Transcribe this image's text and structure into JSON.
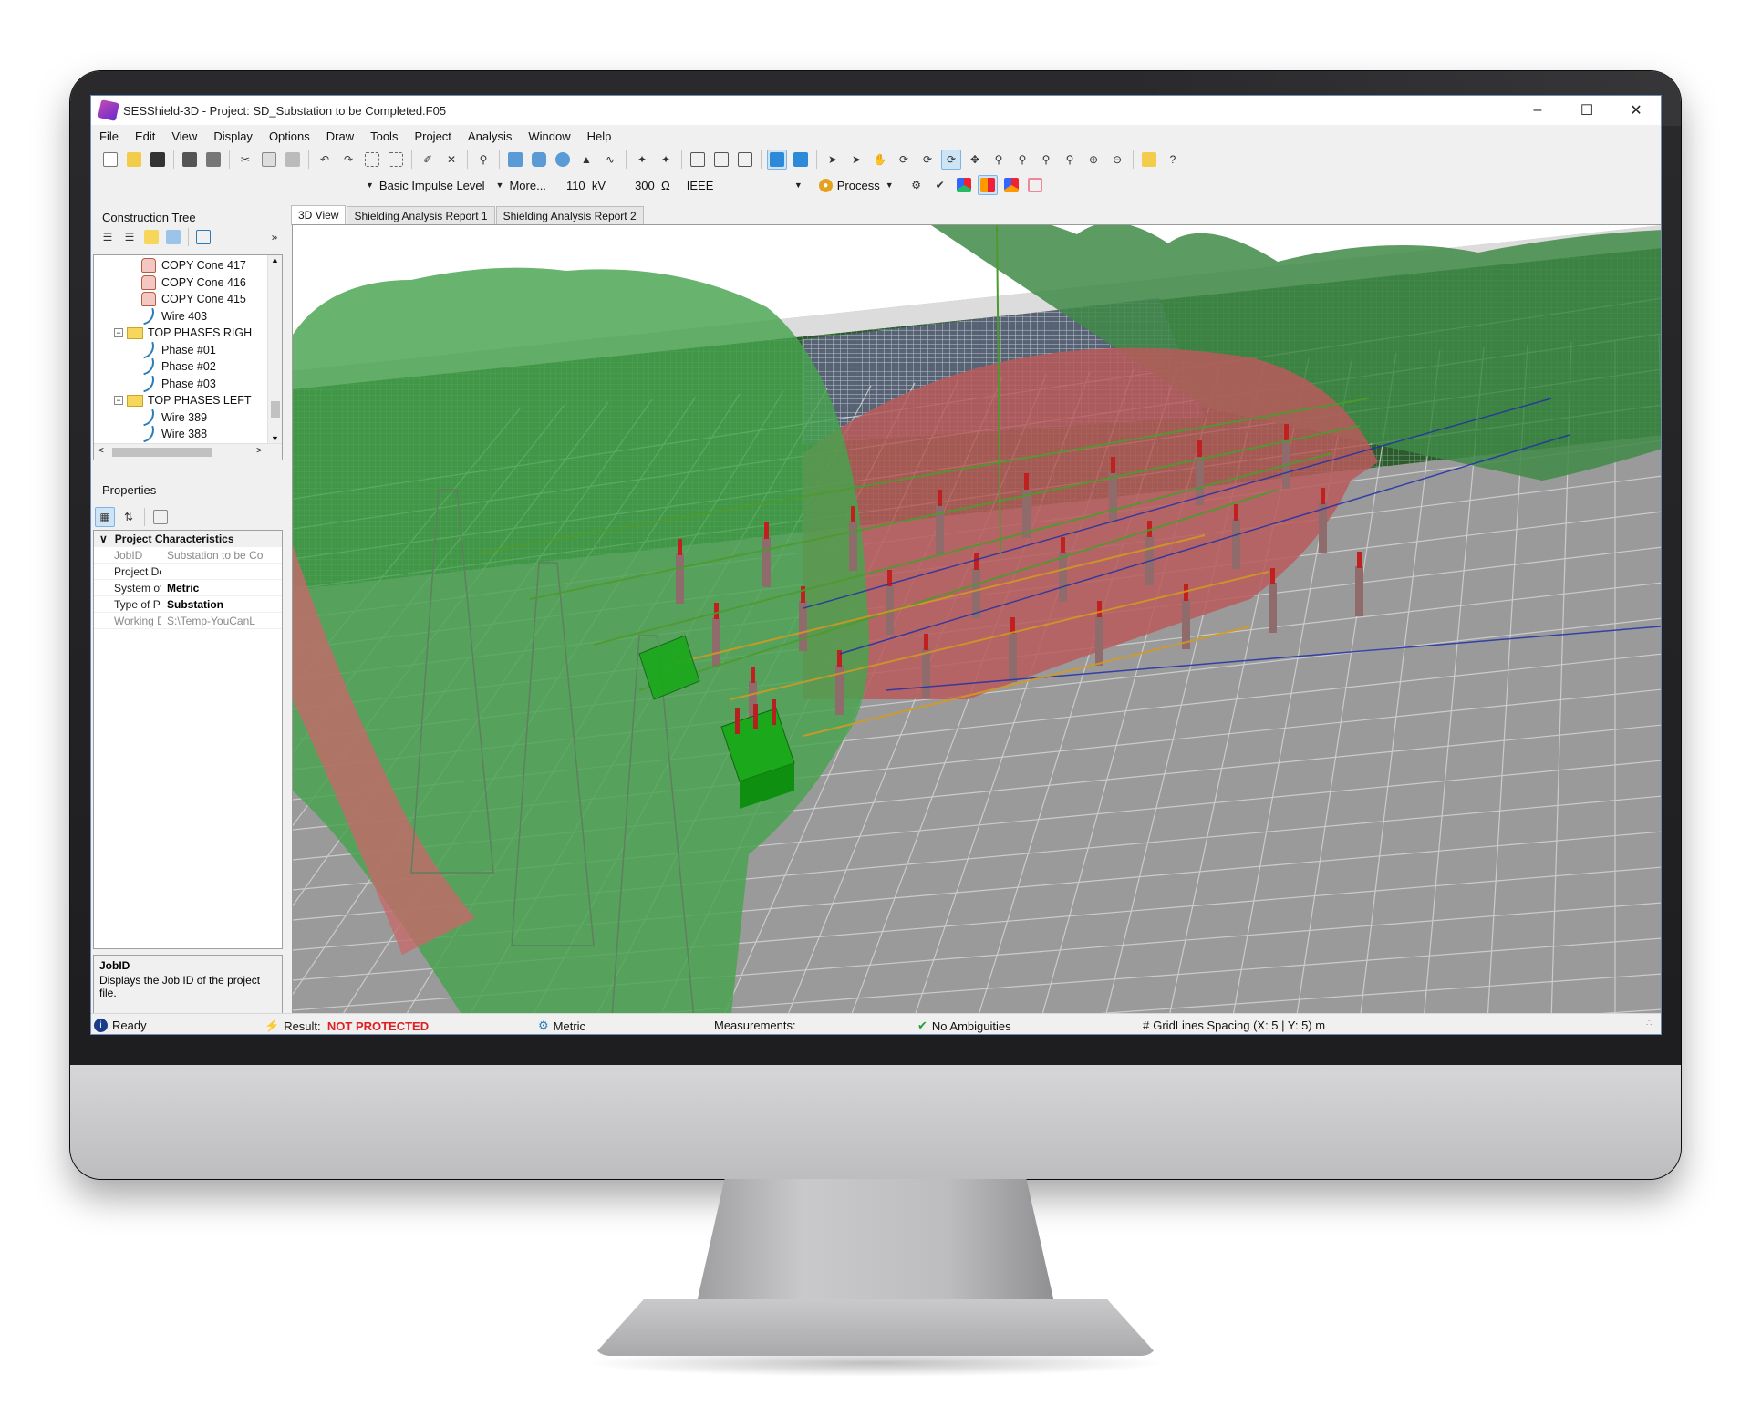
{
  "window": {
    "title": "SESShield-3D - Project: SD_Substation to be Completed.F05",
    "controls": [
      "minimize",
      "maximize",
      "close"
    ]
  },
  "menu": [
    "File",
    "Edit",
    "View",
    "Display",
    "Options",
    "Draw",
    "Tools",
    "Project",
    "Analysis",
    "Window",
    "Help"
  ],
  "toolbar2": {
    "impulse_label": "Basic Impulse Level",
    "more_label": "More...",
    "voltage_value": "110",
    "voltage_unit": "kV",
    "resistance_value": "300",
    "resistance_unit": "Ω",
    "standard_value": "IEEE",
    "process_label": "Process"
  },
  "construction_tree": {
    "title": "Construction Tree",
    "items": [
      {
        "label": "COPY Cone 417",
        "icon": "cone-icon",
        "indent": 2
      },
      {
        "label": "COPY Cone 416",
        "icon": "cone-icon",
        "indent": 2
      },
      {
        "label": "COPY Cone 415",
        "icon": "cone-icon",
        "indent": 2
      },
      {
        "label": "Wire  403",
        "icon": "wire-icon",
        "indent": 2
      },
      {
        "label": "TOP PHASES RIGH",
        "icon": "folder-icon",
        "indent": 1
      },
      {
        "label": "Phase #01",
        "icon": "wire-icon",
        "indent": 2
      },
      {
        "label": "Phase #02",
        "icon": "wire-icon",
        "indent": 2
      },
      {
        "label": "Phase #03",
        "icon": "wire-icon",
        "indent": 2
      },
      {
        "label": "TOP PHASES LEFT",
        "icon": "folder-icon",
        "indent": 1
      },
      {
        "label": "Wire  389",
        "icon": "wire-icon",
        "indent": 2
      },
      {
        "label": "Wire  388",
        "icon": "wire-icon",
        "indent": 2
      }
    ]
  },
  "properties": {
    "title": "Properties",
    "category": "Project Characteristics",
    "rows": [
      {
        "key": "JobID",
        "value": "Substation to be Co",
        "style": "dim"
      },
      {
        "key": "Project Desc",
        "value": "",
        "style": "normal"
      },
      {
        "key": "System of U",
        "value": "Metric",
        "style": "bold"
      },
      {
        "key": "Type of Proj",
        "value": "Substation",
        "style": "bold"
      },
      {
        "key": "Working Dir",
        "value": "S:\\Temp-YouCanL",
        "style": "dim"
      }
    ],
    "help_title": "JobID",
    "help_text": "Displays the Job ID of the project file."
  },
  "tabs": [
    "3D View",
    "Shielding Analysis Report 1",
    "Shielding Analysis Report 2"
  ],
  "status": {
    "ready": "Ready",
    "result_label": "Result:",
    "result_value": "NOT PROTECTED",
    "units": "Metric",
    "measurements": "Measurements:",
    "ambiguities": "No Ambiguities",
    "grid": "GridLines Spacing (X: 5 | Y: 5) m"
  },
  "colors": {
    "protected_zone": "#3f9a48",
    "unprotected_zone": "#b85a5a",
    "result_error": "#e02020",
    "accent": "#0078d7"
  }
}
